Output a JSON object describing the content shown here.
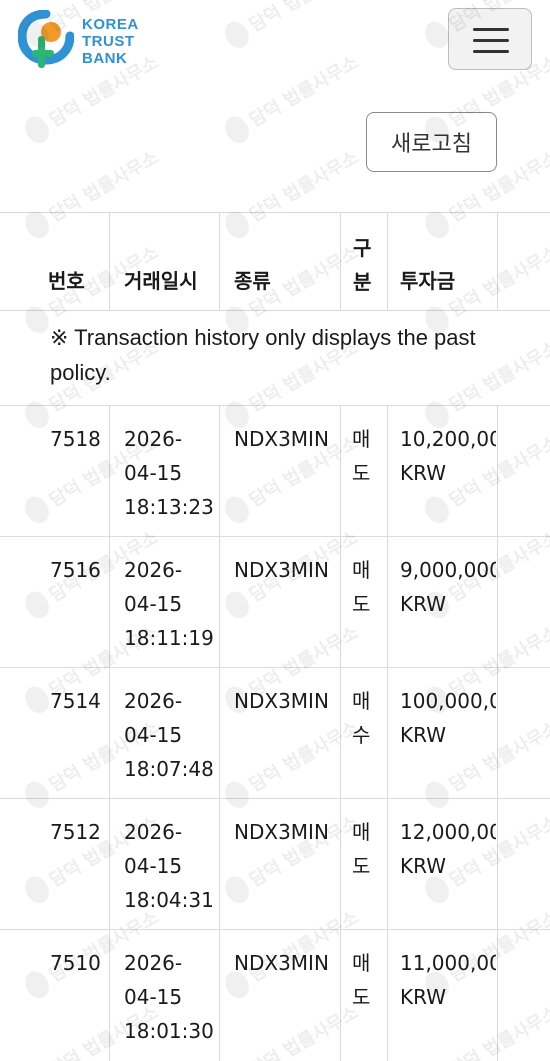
{
  "brand": {
    "line1": "KOREA",
    "line2": "TRUST",
    "line3": "BANK"
  },
  "colors": {
    "brand_blue": "#2f92d4",
    "brand_orange": "#f39a2b",
    "brand_green": "#2bb673"
  },
  "header": {
    "menu_icon": "hamburger-menu-icon"
  },
  "refresh_label": "새로고침",
  "table": {
    "headers": {
      "no": "번호",
      "datetime": "거래일시",
      "type": "종류",
      "side": "구분",
      "amount": "투자금"
    },
    "notice_line1": "※ Transaction history only displays the past",
    "notice_line2": "policy.",
    "rows": [
      {
        "no": "7518",
        "date": "2026-",
        "date2": "04-15",
        "time": "18:13:23",
        "type": "NDX3MIN",
        "side": "매도",
        "amount": "10,200,00",
        "currency": "KRW"
      },
      {
        "no": "7516",
        "date": "2026-",
        "date2": "04-15",
        "time": "18:11:19",
        "type": "NDX3MIN",
        "side": "매도",
        "amount": "9,000,000",
        "currency": "KRW"
      },
      {
        "no": "7514",
        "date": "2026-",
        "date2": "04-15",
        "time": "18:07:48",
        "type": "NDX3MIN",
        "side": "매수",
        "amount": "100,000,0",
        "currency": "KRW"
      },
      {
        "no": "7512",
        "date": "2026-",
        "date2": "04-15",
        "time": "18:04:31",
        "type": "NDX3MIN",
        "side": "매도",
        "amount": "12,000,00",
        "currency": "KRW"
      },
      {
        "no": "7510",
        "date": "2026-",
        "date2": "04-15",
        "time": "18:01:30",
        "type": "NDX3MIN",
        "side": "매도",
        "amount": "11,000,00",
        "currency": "KRW"
      }
    ]
  },
  "watermark_text": "담덕 법률사무소"
}
